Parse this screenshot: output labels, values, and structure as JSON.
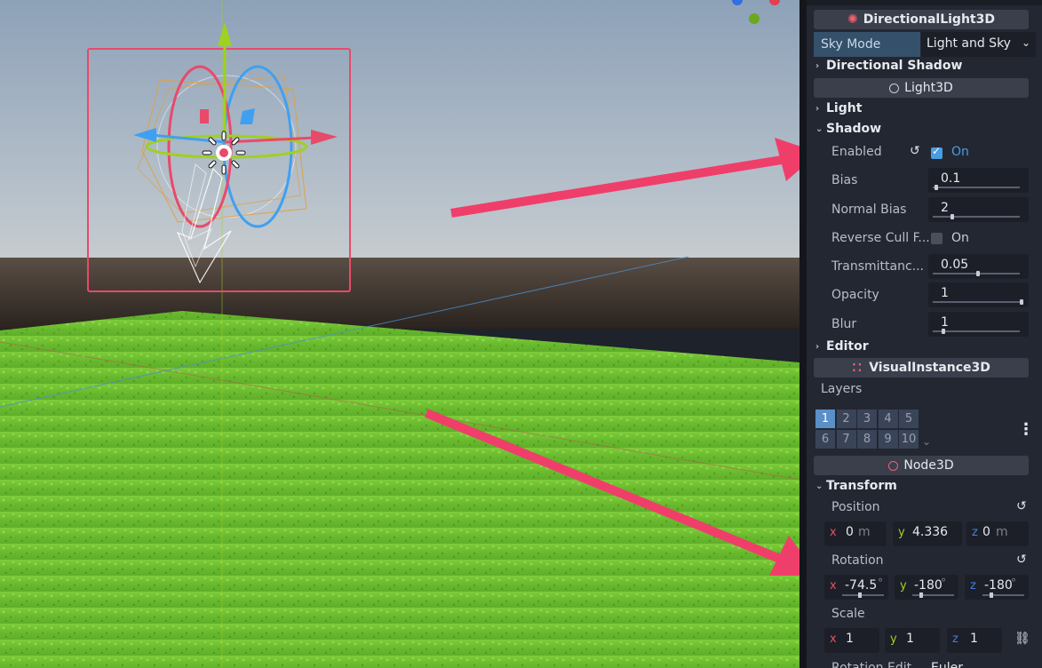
{
  "inspector": {
    "categories": {
      "directional_light": "DirectionalLight3D",
      "light3d": "Light3D",
      "visual_instance": "VisualInstance3D",
      "node3d": "Node3D"
    },
    "sky_mode": {
      "label": "Sky Mode",
      "value": "Light and Sky"
    },
    "sections": {
      "directional_shadow": "Directional Shadow",
      "light": "Light",
      "shadow": "Shadow",
      "editor": "Editor",
      "transform": "Transform"
    },
    "shadow": {
      "enabled": {
        "label": "Enabled",
        "value": "On",
        "checked": true
      },
      "bias": {
        "label": "Bias",
        "value": "0.1",
        "fill": 0.02
      },
      "normal_bias": {
        "label": "Normal Bias",
        "value": "2",
        "fill": 0.2
      },
      "reverse_cull": {
        "label": "Reverse Cull F...",
        "value": "On",
        "checked": false
      },
      "transmittance": {
        "label": "Transmittanc...",
        "value": "0.05",
        "fill": 0.5
      },
      "opacity": {
        "label": "Opacity",
        "value": "1",
        "fill": 1.0
      },
      "blur": {
        "label": "Blur",
        "value": "1",
        "fill": 0.1
      }
    },
    "layers": {
      "label": "Layers",
      "row1": [
        "1",
        "2",
        "3",
        "4",
        "5"
      ],
      "row2": [
        "6",
        "7",
        "8",
        "9",
        "10"
      ],
      "active": "1"
    },
    "transform": {
      "position": {
        "label": "Position",
        "x": "0",
        "y": "4.336",
        "z": "0",
        "unit": "m"
      },
      "rotation": {
        "label": "Rotation",
        "x": "-74.5",
        "y": "-180",
        "z": "-180",
        "unit": "°"
      },
      "scale": {
        "label": "Scale",
        "x": "1",
        "y": "1",
        "z": "1"
      },
      "rotation_edit": "Rotation Edit...",
      "rotation_edit_value": "Euler"
    },
    "axis_labels": {
      "x": "x",
      "y": "y",
      "z": "z"
    }
  },
  "colors": {
    "accent": "#4a9de0",
    "annotation_arrow": "#f03e6a",
    "selection_box": "#e84a6a",
    "axis_x": "#e8506a",
    "axis_y": "#a0d020",
    "axis_z": "#40a0f0"
  },
  "icons": [
    "directional-light-icon",
    "light3d-circle-icon",
    "visual-instance-dots-icon",
    "node3d-circle-icon",
    "reset-icon",
    "checkbox-icon",
    "kebab-menu-icon",
    "chain-link-icon",
    "chevron-down-icon",
    "chevron-right-icon"
  ]
}
